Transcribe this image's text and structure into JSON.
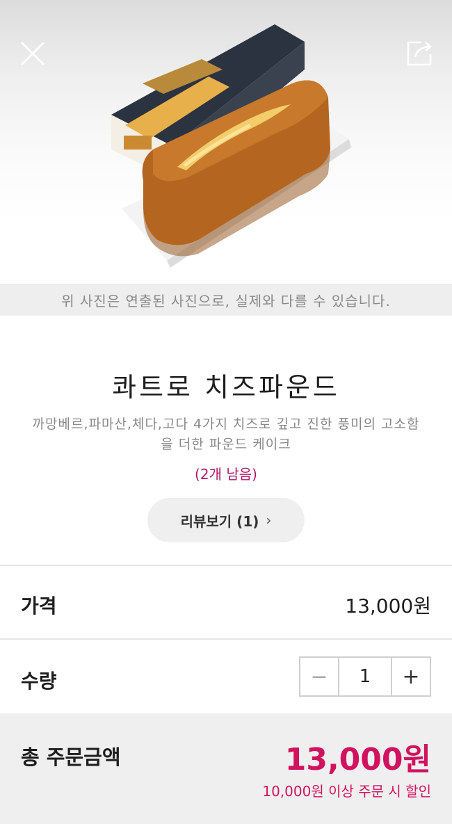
{
  "header": {
    "close_icon": "close-icon",
    "share_icon": "share-icon"
  },
  "notice": "위 사진은 연출된 사진으로, 실제와 다를 수 있습니다.",
  "product": {
    "title": "콰트로 치즈파운드",
    "description": "까망베르,파마산,체다,고다 4가지 치즈로 깊고 진한 풍미의 고소함을 더한 파운드 케이크",
    "stock": "(2개 남음)",
    "review_button": "리뷰보기 (1)"
  },
  "price": {
    "label": "가격",
    "value": "13,000원"
  },
  "quantity": {
    "label": "수량",
    "value": "1",
    "minus": "−",
    "plus": "+"
  },
  "total": {
    "label": "총 주문금액",
    "value": "13,000원",
    "note": "10,000원 이상 주문 시 할인"
  },
  "colors": {
    "accent": "#d1125f",
    "stock": "#b0176a",
    "gray_bg": "#efefef"
  }
}
